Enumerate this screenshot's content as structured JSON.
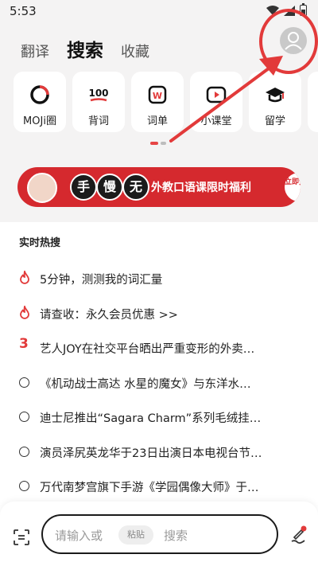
{
  "status": {
    "time": "5:53"
  },
  "tabs": [
    {
      "label": "翻译"
    },
    {
      "label": "搜索"
    },
    {
      "label": "收藏"
    }
  ],
  "shortcuts": [
    {
      "label": "MOJi圈",
      "icon": "moji-ring-icon"
    },
    {
      "label": "背词",
      "icon": "100-icon",
      "glyph": "100"
    },
    {
      "label": "词单",
      "icon": "wordlist-icon",
      "glyph": "W"
    },
    {
      "label": "小课堂",
      "icon": "play-icon"
    },
    {
      "label": "留学",
      "icon": "graduation-cap-icon"
    }
  ],
  "banner": {
    "chars": [
      "手",
      "慢",
      "无"
    ],
    "text": "外教口语课限时福利",
    "cta": "立即预约"
  },
  "hot": {
    "title": "实时热搜",
    "items": [
      {
        "type": "fire",
        "text": "5分钟，测测我的词汇量"
      },
      {
        "type": "fire",
        "text": "请查收：永久会员优惠 >>"
      },
      {
        "type": "rank",
        "rank": "3",
        "text": "艺人JOY在社交平台晒出严重变形的外卖…"
      },
      {
        "type": "circle",
        "text": "《机动战士高达 水星的魔女》与东洋水…"
      },
      {
        "type": "circle",
        "text": "迪士尼推出“Sagara Charm”系列毛绒挂…"
      },
      {
        "type": "circle",
        "text": "演员泽尻英龙华于23日出演日本电视台节…"
      },
      {
        "type": "circle",
        "text": "万代南梦宫旗下手游《学园偶像大师》于…"
      }
    ]
  },
  "search": {
    "hint": "请输入或",
    "paste": "粘贴",
    "hint2": "搜索"
  },
  "colors": {
    "accent": "#e23a3a",
    "banner": "#d5292e"
  }
}
